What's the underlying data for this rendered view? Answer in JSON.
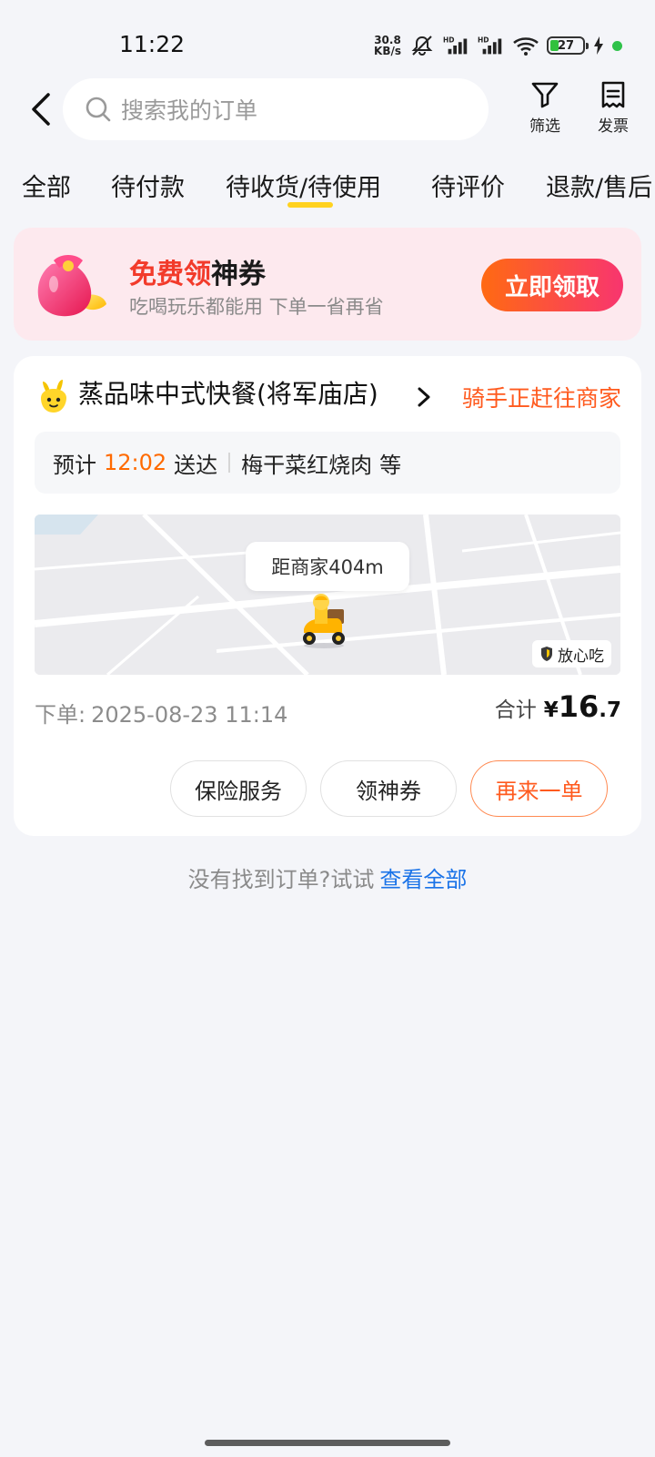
{
  "status_bar": {
    "time": "11:22",
    "net_speed_value": "30.8",
    "net_speed_unit": "KB/s",
    "battery": "27"
  },
  "header": {
    "search_placeholder": "搜索我的订单",
    "filter_label": "筛选",
    "invoice_label": "发票"
  },
  "tabs": [
    {
      "label": "全部",
      "active": false
    },
    {
      "label": "待付款",
      "active": false
    },
    {
      "label": "待收货/待使用",
      "active": true
    },
    {
      "label": "待评价",
      "active": false
    },
    {
      "label": "退款/售后",
      "active": false
    }
  ],
  "promo": {
    "title_highlight": "免费领",
    "title_rest": "神券",
    "subtitle": "吃喝玩乐都能用 下单一省再省",
    "button": "立即领取"
  },
  "order": {
    "shop_name": "蒸品味中式快餐(将军庙店)",
    "status": "骑手正赶往商家",
    "eta_prefix": "预计",
    "eta_time": "12:02",
    "eta_suffix": "送达",
    "item_name": "梅干菜红烧肉",
    "item_suffix": "等",
    "map_distance": "距商家404m",
    "safe_tag": "放心吃",
    "order_time_label": "下单:",
    "order_time": "2025-08-23 11:14",
    "total_label": "合计",
    "currency": "¥",
    "total_integer": "16",
    "total_decimal": ".7",
    "actions": [
      "保险服务",
      "领神券",
      "再来一单"
    ]
  },
  "footer": {
    "not_found_text": "没有找到订单?试试",
    "view_all": "查看全部"
  },
  "colors": {
    "accent_orange": "#ff5a1e",
    "tab_underline": "#ffd21f",
    "link_blue": "#1a73e8",
    "promo_bg": "#fde9ee"
  }
}
